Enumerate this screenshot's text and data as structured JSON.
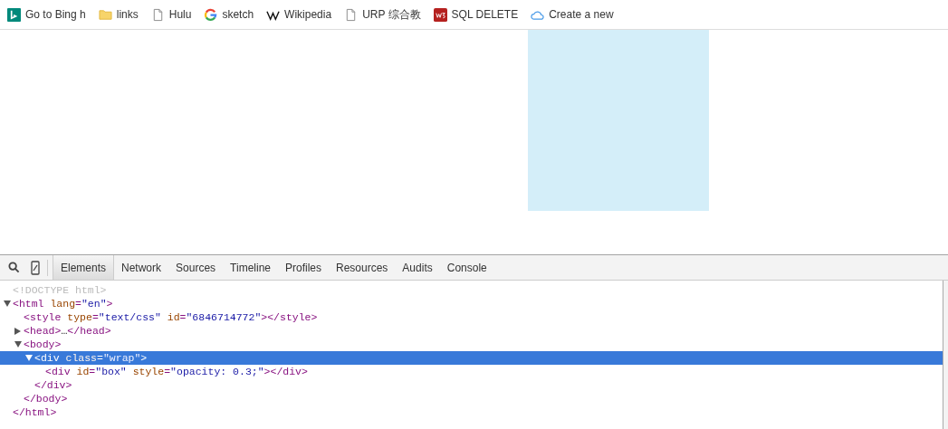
{
  "bookmarks": [
    {
      "kind": "bing",
      "label": "Go to Bing h"
    },
    {
      "kind": "folder",
      "label": "links"
    },
    {
      "kind": "page",
      "label": "Hulu"
    },
    {
      "kind": "google",
      "label": "sketch"
    },
    {
      "kind": "wiki",
      "label": "Wikipedia"
    },
    {
      "kind": "page",
      "label": "URP 综合教"
    },
    {
      "kind": "w3",
      "label": "SQL DELETE"
    },
    {
      "kind": "cloud",
      "label": "Create a new"
    }
  ],
  "devtools": {
    "tabs": [
      {
        "label": "Elements",
        "selected": true
      },
      {
        "label": "Network",
        "selected": false
      },
      {
        "label": "Sources",
        "selected": false
      },
      {
        "label": "Timeline",
        "selected": false
      },
      {
        "label": "Profiles",
        "selected": false
      },
      {
        "label": "Resources",
        "selected": false
      },
      {
        "label": "Audits",
        "selected": false
      },
      {
        "label": "Console",
        "selected": false
      }
    ],
    "tree": [
      {
        "selected": false,
        "open": [
          {
            "kind": "doctype",
            "text": "<!DOCTYPE html>"
          }
        ]
      },
      {
        "selected": false,
        "expanded": true,
        "open": [
          {
            "kind": "tag",
            "text": "<html "
          },
          {
            "kind": "attr",
            "text": "lang"
          },
          {
            "kind": "tag",
            "text": "="
          },
          {
            "kind": "value",
            "text": "\"en\""
          },
          {
            "kind": "tag",
            "text": ">"
          }
        ],
        "children": [
          {
            "selected": false,
            "open": [
              {
                "kind": "tag",
                "text": "<style "
              },
              {
                "kind": "attr",
                "text": "type"
              },
              {
                "kind": "tag",
                "text": "="
              },
              {
                "kind": "value",
                "text": "\"text/css\""
              },
              {
                "kind": "attr",
                "text": " id"
              },
              {
                "kind": "tag",
                "text": "="
              },
              {
                "kind": "value",
                "text": "\"6846714772\""
              },
              {
                "kind": "tag",
                "text": "></style>"
              }
            ]
          },
          {
            "selected": false,
            "expanded": false,
            "open": [
              {
                "kind": "tag",
                "text": "<head>"
              },
              {
                "kind": "plain",
                "text": "…"
              },
              {
                "kind": "tag",
                "text": "</head>"
              }
            ]
          },
          {
            "selected": false,
            "expanded": true,
            "open": [
              {
                "kind": "tag",
                "text": "<body>"
              }
            ],
            "children": [
              {
                "selected": true,
                "expanded": true,
                "open": [
                  {
                    "kind": "tag",
                    "text": "<div "
                  },
                  {
                    "kind": "attr",
                    "text": "class"
                  },
                  {
                    "kind": "tag",
                    "text": "="
                  },
                  {
                    "kind": "value",
                    "text": "\"wrap\""
                  },
                  {
                    "kind": "tag",
                    "text": ">"
                  }
                ],
                "children": [
                  {
                    "selected": false,
                    "open": [
                      {
                        "kind": "tag",
                        "text": "<div "
                      },
                      {
                        "kind": "attr",
                        "text": "id"
                      },
                      {
                        "kind": "tag",
                        "text": "="
                      },
                      {
                        "kind": "value",
                        "text": "\"box\""
                      },
                      {
                        "kind": "attr",
                        "text": " style"
                      },
                      {
                        "kind": "tag",
                        "text": "="
                      },
                      {
                        "kind": "value",
                        "text": "\"opacity: 0.3;\""
                      },
                      {
                        "kind": "tag",
                        "text": "></div>"
                      }
                    ]
                  }
                ],
                "close": [
                  {
                    "kind": "tag",
                    "text": "</div>"
                  }
                ]
              }
            ],
            "close": [
              {
                "kind": "tag",
                "text": "</body>"
              }
            ]
          }
        ],
        "close": [
          {
            "kind": "tag",
            "text": "</html>"
          }
        ]
      }
    ]
  }
}
